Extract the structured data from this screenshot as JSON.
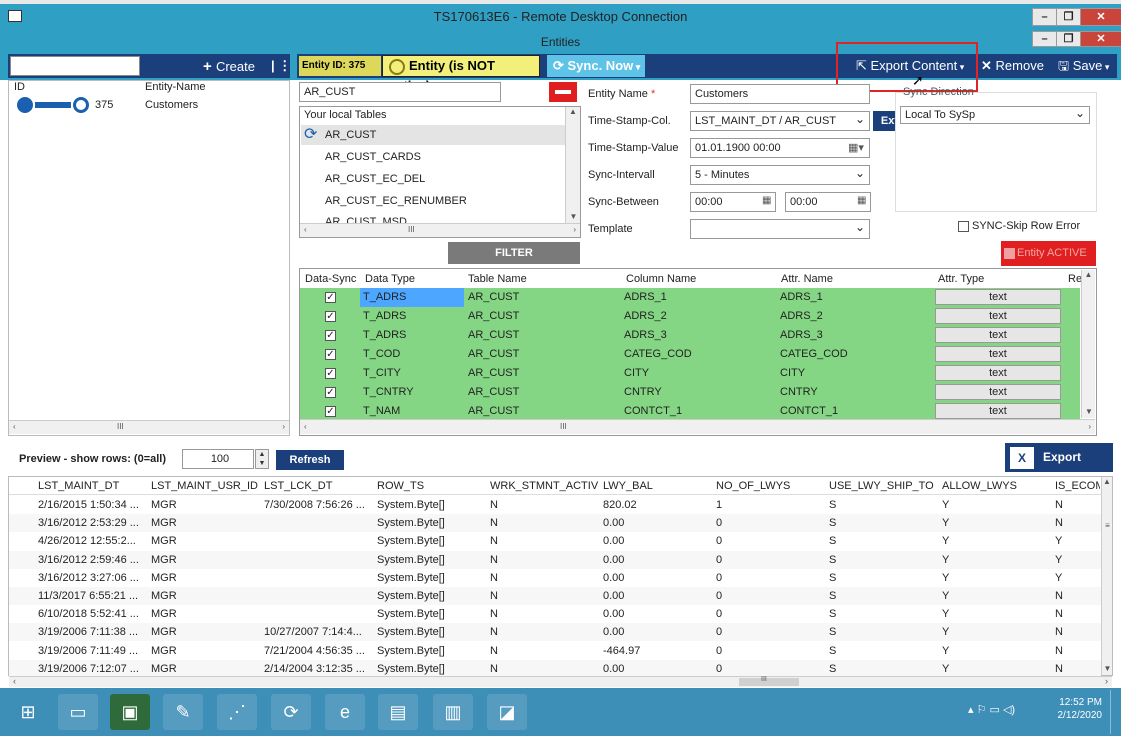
{
  "window": {
    "rdp_title": "TS170613E6 - Remote Desktop Connection",
    "app_title": "Entities"
  },
  "left": {
    "create_label": "Create",
    "col_id": "ID",
    "col_name": "Entity-Name",
    "row_id": "375",
    "row_name": "Customers"
  },
  "toolbar": {
    "entity_id": "Entity ID:  375",
    "entity_status": "Entity (is NOT active)",
    "sync_now": "Sync. Now",
    "export_content": "Export Content",
    "remove": "Remove",
    "save": "Save"
  },
  "tables": {
    "search_value": "AR_CUST",
    "header": "Your local Tables",
    "items": [
      "AR_CUST",
      "AR_CUST_CARDS",
      "AR_CUST_EC_DEL",
      "AR_CUST_EC_RENUMBER",
      "AR_CUST_MSD"
    ],
    "filter_label": "FILTER"
  },
  "form": {
    "entity_name_label": "Entity Name",
    "entity_name_value": "Customers",
    "ts_col_label": "Time-Stamp-Col.",
    "ts_col_value": "LST_MAINT_DT / AR_CUST",
    "ext_label": "Ext.",
    "ts_value_label": "Time-Stamp-Value",
    "ts_value_value": "01.01.1900 00:00",
    "interval_label": "Sync-Intervall",
    "interval_value": "5 - Minutes",
    "between_label": "Sync-Between",
    "between_from": "00:00",
    "between_to": "00:00",
    "template_label": "Template",
    "template_value": "",
    "sync_direction_label": "Sync Direction",
    "sync_direction_value": "Local To SySp",
    "skip_error_label": "SYNC-Skip Row Error",
    "entity_active_label": "Entity ACTIVE"
  },
  "grid": {
    "headers": [
      "Data-Sync",
      "Data Type",
      "Table Name",
      "Column Name",
      "Attr. Name",
      "Attr. Type",
      "Re"
    ],
    "rows": [
      [
        "T_ADRS",
        "AR_CUST",
        "ADRS_1",
        "ADRS_1",
        "text"
      ],
      [
        "T_ADRS",
        "AR_CUST",
        "ADRS_2",
        "ADRS_2",
        "text"
      ],
      [
        "T_ADRS",
        "AR_CUST",
        "ADRS_3",
        "ADRS_3",
        "text"
      ],
      [
        "T_COD",
        "AR_CUST",
        "CATEG_COD",
        "CATEG_COD",
        "text"
      ],
      [
        "T_CITY",
        "AR_CUST",
        "CITY",
        "CITY",
        "text"
      ],
      [
        "T_CNTRY",
        "AR_CUST",
        "CNTRY",
        "CNTRY",
        "text"
      ],
      [
        "T_NAM",
        "AR_CUST",
        "CONTCT_1",
        "CONTCT_1",
        "text"
      ]
    ]
  },
  "preview": {
    "label": "Preview - show rows: (0=all)",
    "rows_value": "100",
    "refresh_label": "Refresh",
    "export_excel_label": "Export Excel",
    "headers": [
      "LST_MAINT_DT",
      "LST_MAINT_USR_ID",
      "LST_LCK_DT",
      "ROW_TS",
      "WRK_STMNT_ACTIV",
      "LWY_BAL",
      "NO_OF_LWYS",
      "USE_LWY_SHIP_TO",
      "ALLOW_LWYS",
      "IS_ECOM"
    ],
    "rows": [
      [
        "2/16/2015 1:50:34 ...",
        "MGR",
        "7/30/2008 7:56:26 ...",
        "System.Byte[]",
        "N",
        "820.02",
        "1",
        "S",
        "Y",
        "N"
      ],
      [
        "3/16/2012 2:53:29 ...",
        "MGR",
        "",
        "System.Byte[]",
        "N",
        "0.00",
        "0",
        "S",
        "Y",
        "N"
      ],
      [
        "4/26/2012 12:55:2...",
        "MGR",
        "",
        "System.Byte[]",
        "N",
        "0.00",
        "0",
        "S",
        "Y",
        "Y"
      ],
      [
        "3/16/2012 2:59:46 ...",
        "MGR",
        "",
        "System.Byte[]",
        "N",
        "0.00",
        "0",
        "S",
        "Y",
        "Y"
      ],
      [
        "3/16/2012 3:27:06 ...",
        "MGR",
        "",
        "System.Byte[]",
        "N",
        "0.00",
        "0",
        "S",
        "Y",
        "Y"
      ],
      [
        "11/3/2017 6:55:21 ...",
        "MGR",
        "",
        "System.Byte[]",
        "N",
        "0.00",
        "0",
        "S",
        "Y",
        "N"
      ],
      [
        "6/10/2018 5:52:41 ...",
        "MGR",
        "",
        "System.Byte[]",
        "N",
        "0.00",
        "0",
        "S",
        "Y",
        "N"
      ],
      [
        "3/19/2006 7:11:38 ...",
        "MGR",
        "10/27/2007 7:14:4...",
        "System.Byte[]",
        "N",
        "0.00",
        "0",
        "S",
        "Y",
        "N"
      ],
      [
        "3/19/2006 7:11:49 ...",
        "MGR",
        "7/21/2004 4:56:35 ...",
        "System.Byte[]",
        "N",
        "-464.97",
        "0",
        "S",
        "Y",
        "N"
      ],
      [
        "3/19/2006 7:12:07 ...",
        "MGR",
        "2/14/2004 3:12:35 ...",
        "System.Byte[]",
        "N",
        "0.00",
        "0",
        "S",
        "Y",
        "N"
      ]
    ]
  },
  "taskbar": {
    "time": "12:52 PM",
    "date": "2/12/2020"
  },
  "colors": {
    "title_bar": "#2f9fc4",
    "navy": "#1a3f7a",
    "row_green": "#84d684",
    "highlight": "#e02424"
  }
}
